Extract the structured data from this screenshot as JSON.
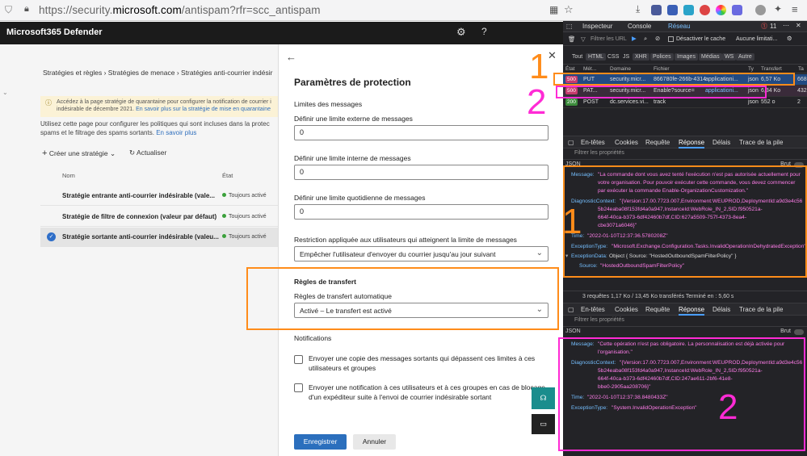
{
  "browser": {
    "url_prefix": "https://security.",
    "url_domain": "microsoft.com",
    "url_path": "/antispam?rfr=scc_antispam",
    "bell_count": "11"
  },
  "ms": {
    "brand": "Microsoft365 Defender",
    "gear": "⚙",
    "help": "?"
  },
  "bg": {
    "crumbs": "Stratégies et règles  ›  Stratégies de menace  ›  Stratégies anti-courrier indésir",
    "banner_line1": "Accédez à la page stratégie de quarantaine pour configurer la notification de courrier i",
    "banner_line2": "indésirable de décembre 2021.",
    "banner_link": "En savoir plus sur la stratégie de mise en quarantaine",
    "desc": "Utilisez cette page pour configurer les politiques qui sont incluses dans la protec spams et le filtrage des spams sortants.",
    "desc_link": "En savoir plus",
    "create": "Créer une stratégie",
    "refresh": "Actualiser",
    "col_name": "Nom",
    "col_state": "État",
    "rows": [
      {
        "name": "Stratégie entrante anti-courrier indésirable (vale...",
        "state": "Toujours activé"
      },
      {
        "name": "Stratégie de filtre de connexion (valeur par défaut)",
        "state": "Toujours activé"
      },
      {
        "name": "Stratégie sortante anti-courrier indésirable (valeu...",
        "state": "Toujours activé"
      }
    ]
  },
  "panel": {
    "title": "Paramètres de protection",
    "limits_section": "Limites des messages",
    "ext_label": "Définir une limite externe de messages",
    "ext_value": "0",
    "int_label": "Définir une limite interne de messages",
    "int_value": "0",
    "daily_label": "Définir une limite quotidienne de messages",
    "daily_value": "0",
    "restrict_label": "Restriction appliquée aux utilisateurs qui atteignent la limite de messages",
    "restrict_value": "Empêcher l'utilisateur d'envoyer du courrier jusqu'au jour suivant",
    "forward_section": "Règles de transfert",
    "forward_label": "Règles de transfert automatique",
    "forward_value": "Activé – Le transfert est activé",
    "notif_section": "Notifications",
    "notif1": "Envoyer une copie des messages sortants qui dépassent ces limites à ces utilisateurs et groupes",
    "notif2": "Envoyer une notification à ces utilisateurs et à ces groupes en cas de blocage d'un expéditeur suite à l'envoi de courrier indésirable sortant",
    "save": "Enregistrer",
    "cancel": "Annuler"
  },
  "devtools": {
    "tabs": [
      "Inspecteur",
      "Console",
      "Réseau"
    ],
    "filter_placeholder": "Filtrer les URL",
    "cache": "Désactiver le cache",
    "throttle": "Aucune limitati...",
    "types": [
      "Tout",
      "HTML",
      "CSS",
      "JS",
      "XHR",
      "Polices",
      "Images",
      "Médias",
      "WS",
      "Autre"
    ],
    "columns": [
      "État",
      "Mét...",
      "Domaine",
      "Fichier",
      "Ty",
      "Transfert",
      "Ta"
    ],
    "requests": [
      {
        "status": "500",
        "method": "PUT",
        "domain": "security.micr...",
        "file": "866780fe-266b-4314",
        "type": "applicationi...",
        "type2": "json",
        "transfer": "6,57 Ko",
        "size": "668"
      },
      {
        "status": "500",
        "method": "PAT...",
        "domain": "security.micr...",
        "file": "Enable?source=",
        "type": "applicationi...",
        "type2": "json",
        "transfer": "6,34 Ko",
        "size": "432"
      },
      {
        "status": "200",
        "method": "POST",
        "domain": "dc.services.vi...",
        "file": "track",
        "type": "",
        "type2": "json",
        "transfer": "552 o",
        "size": "2"
      }
    ],
    "subtabs": [
      "En-têtes",
      "Cookies",
      "Requête",
      "Réponse",
      "Délais",
      "Trace de la pile"
    ],
    "filter_props": "Filtrer les propriétés",
    "json": "JSON",
    "brut": "Brut",
    "resp1": {
      "message_key": "Message:",
      "message_l1": "\"La commande dont vous avez tenté l'exécution n'est pas autorisée actuellement pour",
      "message_l2": "votre organisation. Pour pouvoir exécuter cette commande, vous devez commencer",
      "message_l3": "par exécuter la commande Enable-OrganizationCustomization.\"",
      "diag_key": "DiagnosticContext:",
      "diag_l1": "\"{Version:17.00.7723.007,Environment:WEUPROD,DeploymentId:a9d3e4c56",
      "diag_l2": "5b24eaba08f153fd4a0a947,InstanceId:WebRole_IN_2,SID:f950521a-",
      "diag_l3": "664f-40ca-b373-6df42460b7df,CID:627a5509-757f-4373-8ea4-",
      "diag_l4": "cbe3071a6046}\"",
      "time_key": "Time:",
      "time_val": "\"2022-01-10T12:37:36.5780208Z\"",
      "exc_key": "ExceptionType:",
      "exc_val": "\"Microsoft.Exchange.Configuration.Tasks.InvalidOperationInDehydratedException\"",
      "excdata_key": "ExceptionData:",
      "excdata_val": "Object { Source: \"HostedOutboundSpamFilterPolicy\" }",
      "source_key": "Source:",
      "source_val": "\"HostedOutboundSpamFilterPolicy\""
    },
    "status_bar": "3 requêtes    1,17 Ko / 13,45 Ko transférés    Terminé en : 5,60 s",
    "resp2": {
      "message_key": "Message:",
      "message_l1": "\"Cette opération n'est pas obligatoire. La personnalisation est déjà activée pour",
      "message_l2": "l'organisation.\"",
      "diag_key": "DiagnosticContext:",
      "diag_l1": "\"{Version:17.00.7723.007,Environment:WEUPROD,DeploymentId:a9d3e4c56",
      "diag_l2": "5b24eaba08f153fd4a0a947,InstanceId:WebRole_IN_2,SID:f950521a-",
      "diag_l3": "664f-40ca-b373-6df42460b7df,CID:247ae611-2bf6-41e8-",
      "diag_l4": "bbe0-2905aa208706}\"",
      "time_key": "Time:",
      "time_val": "\"2022-01-10T12:37:38.8480433Z\"",
      "exc_key": "ExceptionType:",
      "exc_val": "\"System.InvalidOperationException\""
    }
  },
  "annotations": {
    "one": "1",
    "two": "2",
    "orange": "#ff8c1a",
    "magenta": "#ff2bd5"
  }
}
